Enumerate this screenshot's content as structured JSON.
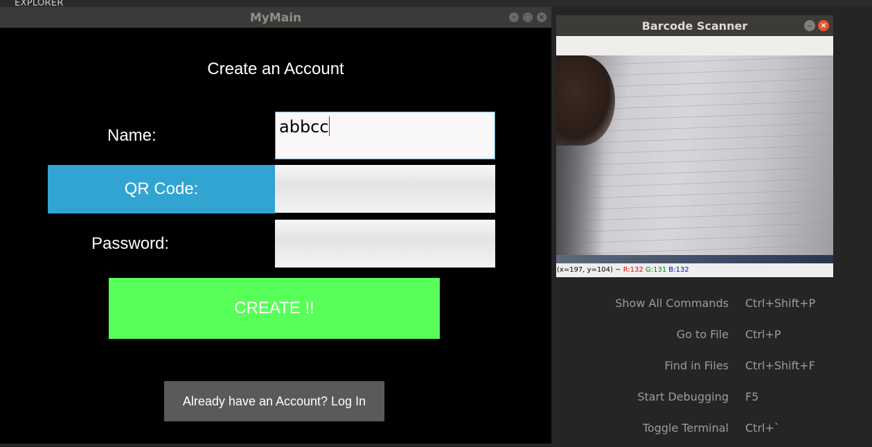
{
  "background": {
    "explorer_label": "EXPLORER"
  },
  "mymain": {
    "title": "MyMain",
    "heading": "Create an Account",
    "name_label": "Name:",
    "name_value": "abbcc",
    "qr_button": "QR Code:",
    "password_label": "Password:",
    "create_button": "CREATE !!",
    "login_button": "Already have an Account? Log In",
    "colors": {
      "qr_button": "#32a4d2",
      "create_button": "#58ff58",
      "login_button": "#5a5a5a"
    }
  },
  "scanner": {
    "title": "Barcode Scanner",
    "status_prefix": "(x=197, y=104) ~",
    "status_r": "R:132",
    "status_g": "G:131",
    "status_b": "B:132"
  },
  "commands": [
    {
      "name": "Show All Commands",
      "key": "Ctrl+Shift+P"
    },
    {
      "name": "Go to File",
      "key": "Ctrl+P"
    },
    {
      "name": "Find in Files",
      "key": "Ctrl+Shift+F"
    },
    {
      "name": "Start Debugging",
      "key": "F5"
    },
    {
      "name": "Toggle Terminal",
      "key": "Ctrl+`"
    }
  ]
}
